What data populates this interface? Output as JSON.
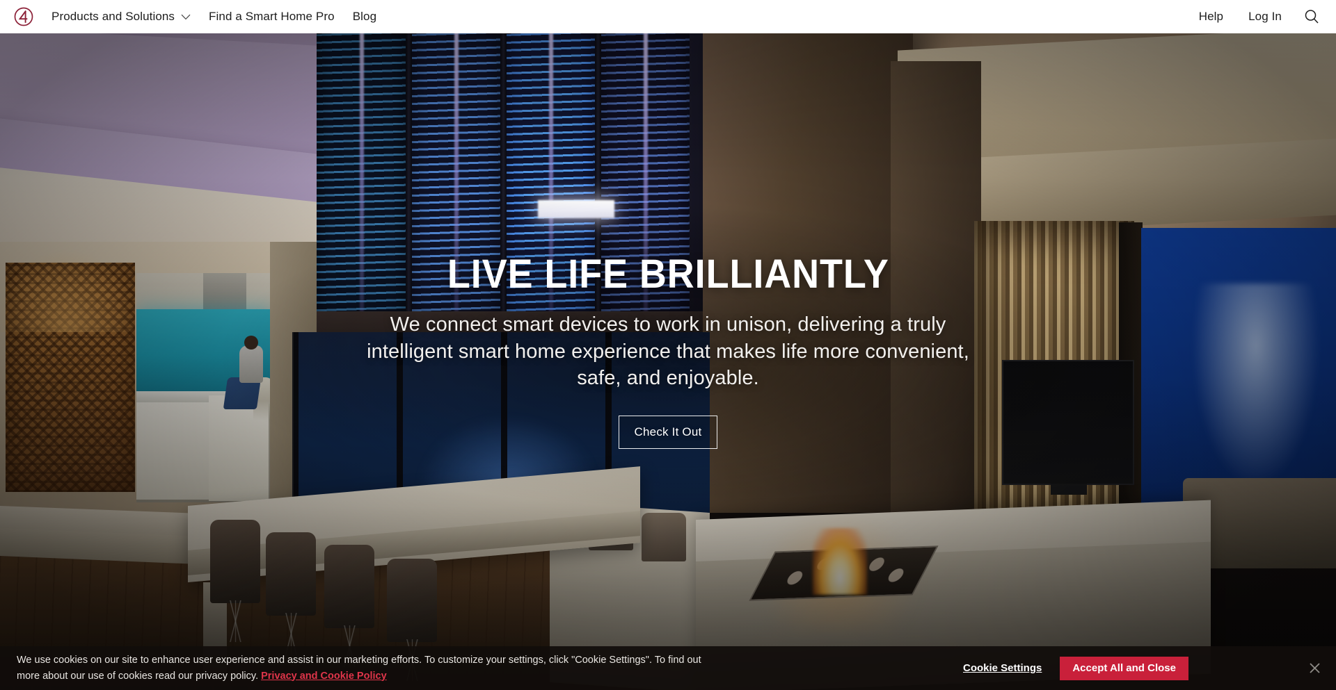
{
  "nav": {
    "logo_alt": "control4-logo",
    "left_links": [
      {
        "label": "Products and Solutions",
        "has_dropdown": true
      },
      {
        "label": "Find a Smart Home Pro",
        "has_dropdown": false
      },
      {
        "label": "Blog",
        "has_dropdown": false
      }
    ],
    "right_links": [
      {
        "label": "Help"
      },
      {
        "label": "Log In"
      }
    ],
    "search_icon": "search-icon",
    "chevron_icon": "chevron-down-icon"
  },
  "hero": {
    "title": "LIVE LIFE BRILLIANTLY",
    "subtitle": "We connect smart devices to work in unison, delivering a truly intelligent smart home experience that makes life more convenient, safe, and enjoyable.",
    "cta_label": "Check It Out"
  },
  "cookie": {
    "message": "We use cookies on our site to enhance user experience and assist in our marketing efforts. To customize your settings, click \"Cookie Settings\". To find out more about our use of cookies read our privacy policy.",
    "policy_link": "Privacy and Cookie Policy",
    "settings_label": "Cookie Settings",
    "accept_label": "Accept All and Close",
    "close_icon": "close-icon"
  },
  "colors": {
    "brand_maroon": "#8c2138",
    "accent_red": "#c9203a",
    "link_red": "#e0354a",
    "nav_bg": "#ffffff",
    "nav_text": "#1d1d1d",
    "hero_text": "#ffffff",
    "banner_bg": "rgba(17,13,11,.93)"
  }
}
